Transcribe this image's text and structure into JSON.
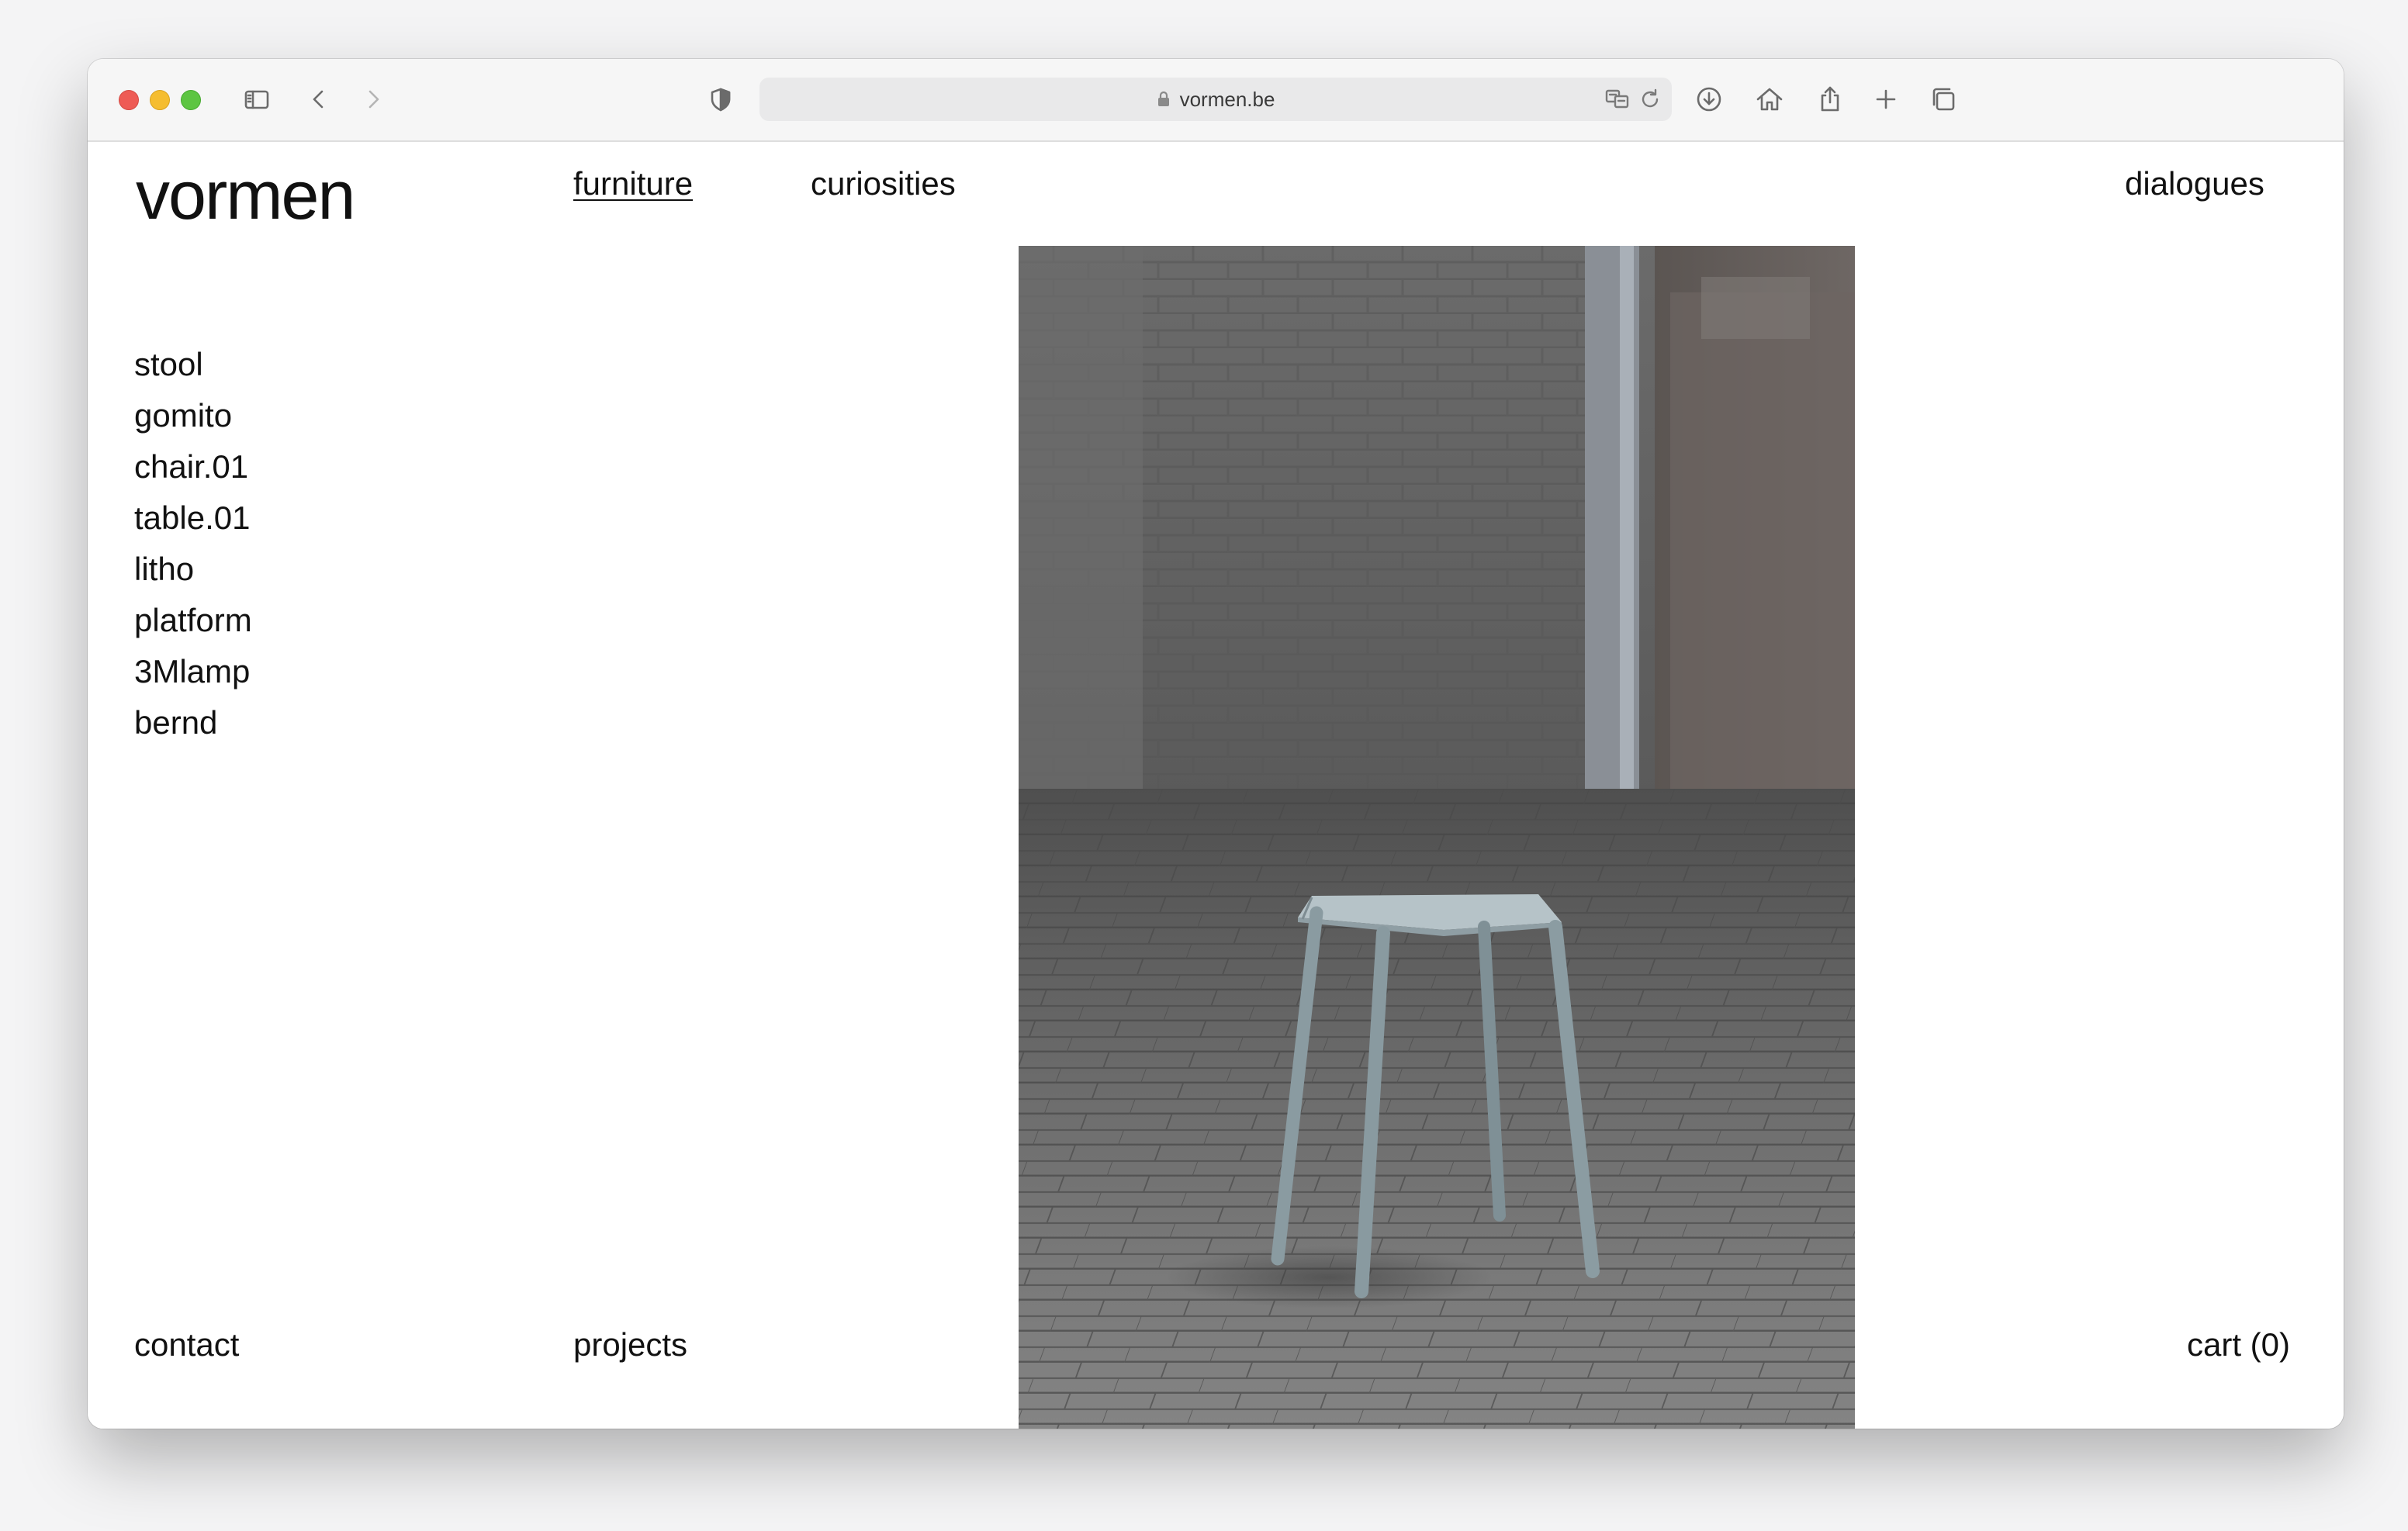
{
  "browser": {
    "url": "vormen.be",
    "icons": {
      "sidebar": "sidebar-icon",
      "back": "chevron-left-icon",
      "forward": "chevron-right-icon",
      "privacy": "shield-icon",
      "lock": "lock-icon",
      "translate": "translate-icon",
      "reload": "reload-icon",
      "download": "download-icon",
      "home": "home-icon",
      "share": "share-icon",
      "new_tab": "plus-icon",
      "tabs": "tabs-overview-icon"
    }
  },
  "site": {
    "logo": "vormen",
    "nav": {
      "furniture": "furniture",
      "curiosities": "curiosities",
      "dialogues": "dialogues"
    },
    "products": [
      "stool",
      "gomito",
      "chair.01",
      "table.01",
      "litho",
      "platform",
      "3Mlamp",
      "bernd"
    ],
    "footer": {
      "contact": "contact",
      "projects": "projects",
      "cart": "cart (0)"
    },
    "hero_image": "photo of a pale blue metal stool on grey brick pavement in front of a brick wall"
  }
}
